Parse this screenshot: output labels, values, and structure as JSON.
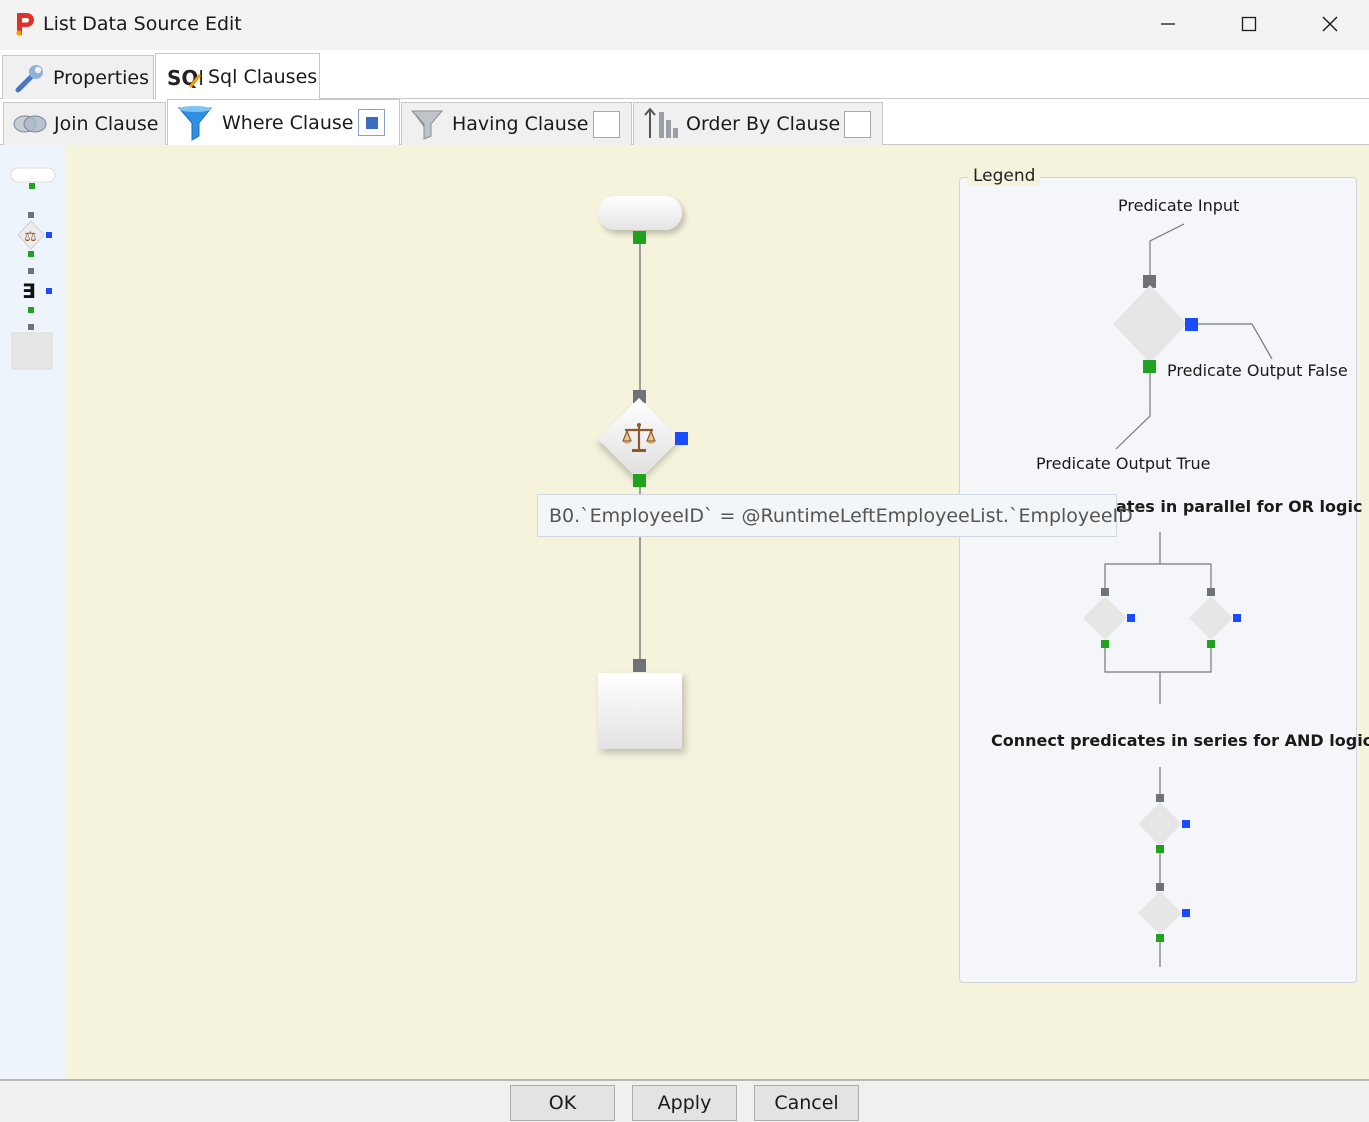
{
  "window": {
    "title": "List Data Source Edit"
  },
  "outer_tabs": [
    {
      "label": "Properties",
      "icon": "wrench-icon",
      "active": false
    },
    {
      "label": "Sql Clauses",
      "icon": "sql-icon",
      "active": true
    }
  ],
  "inner_tabs": [
    {
      "label": "Join Clause",
      "icon": "join-icon",
      "active": false
    },
    {
      "label": "Where Clause",
      "icon": "funnel-icon",
      "active": true,
      "checked": true
    },
    {
      "label": "Having Clause",
      "icon": "funnel-gray-icon",
      "active": false,
      "checked": false
    },
    {
      "label": "Order By Clause",
      "icon": "sort-icon",
      "active": false,
      "checked": false
    }
  ],
  "canvas": {
    "tooltip": "B0.`EmployeeID` = @RuntimeLeftEmployeeList.`EmployeeID`"
  },
  "legend": {
    "title": "Legend",
    "predicate_input": "Predicate Input",
    "predicate_output_false": "Predicate Output False",
    "predicate_output_true": "Predicate Output True",
    "or_logic": "ates in parallel for OR logic",
    "and_logic": "Connect predicates in series for AND logic"
  },
  "buttons": {
    "ok": "OK",
    "apply": "Apply",
    "cancel": "Cancel"
  },
  "colors": {
    "port_input": "#6f7378",
    "port_true": "#1fa31f",
    "port_false": "#1a4bff",
    "canvas_bg": "#f5f3dc"
  }
}
